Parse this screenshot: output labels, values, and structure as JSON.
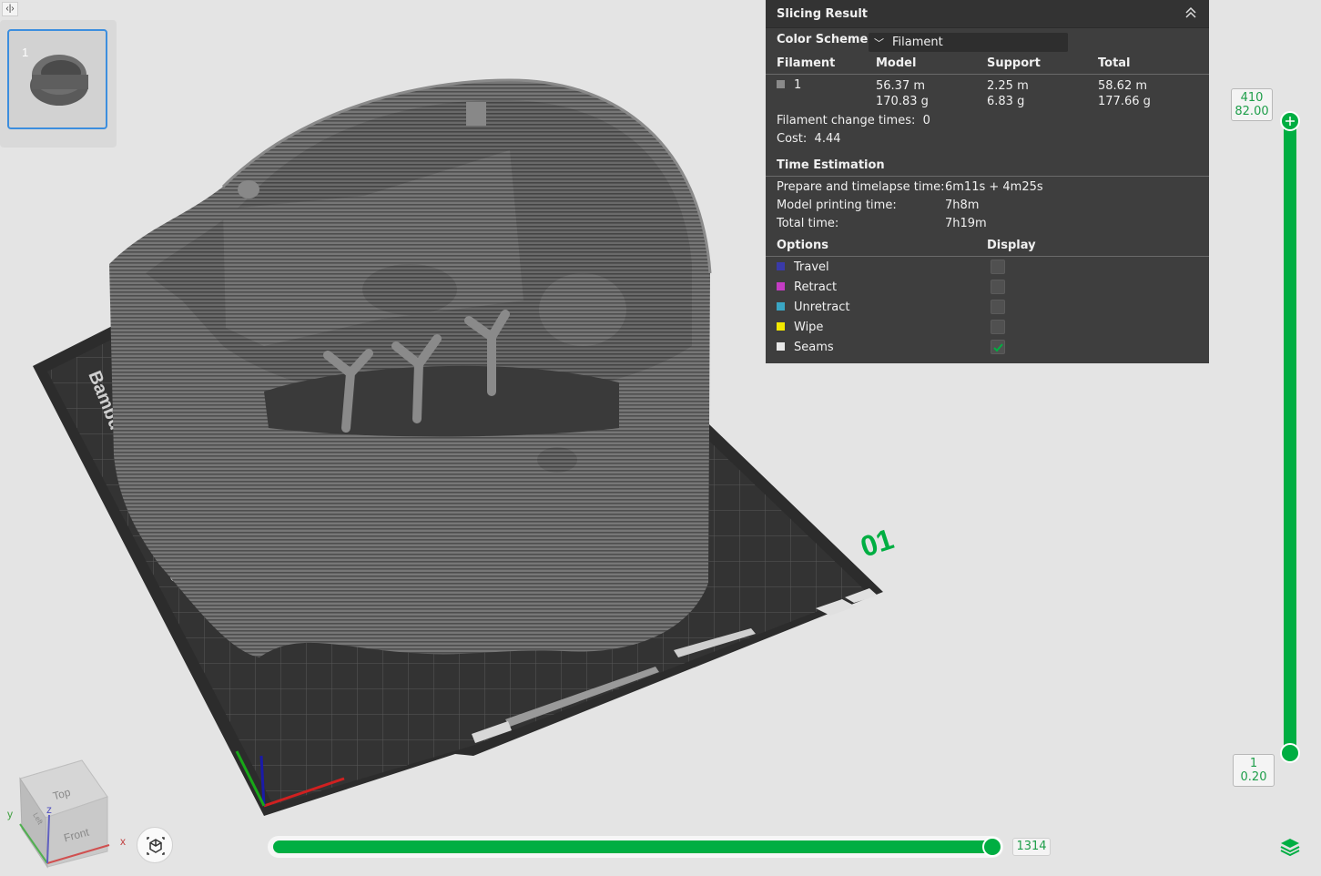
{
  "thumbnail": {
    "plate_number": "1"
  },
  "bed": {
    "plate_label": "01",
    "brand_text": "Bambu Textured PEI Plate"
  },
  "navcube": {
    "top": "Top",
    "front": "Front",
    "left": "Left",
    "axis_x": "x",
    "axis_y": "y",
    "axis_z": "z"
  },
  "panel": {
    "title": "Slicing Result",
    "color_scheme_label": "Color Scheme",
    "color_scheme_value": "Filament",
    "columns": [
      "Filament",
      "Model",
      "Support",
      "Total"
    ],
    "filament_row": {
      "id": "1",
      "color": "#8a8a8a",
      "model_len": "56.37 m",
      "model_wt": "170.83 g",
      "support_len": "2.25 m",
      "support_wt": "6.83 g",
      "total_len": "58.62 m",
      "total_wt": "177.66 g"
    },
    "change_times_label": "Filament change times:",
    "change_times_value": "0",
    "cost_label": "Cost:",
    "cost_value": "4.44",
    "time_section": "Time Estimation",
    "prepare_label": "Prepare and timelapse time:",
    "prepare_value": "6m11s + 4m25s",
    "model_time_label": "Model printing time:",
    "model_time_value": "7h8m",
    "total_time_label": "Total time:",
    "total_time_value": "7h19m",
    "options_header": "Options",
    "display_header": "Display",
    "options": [
      {
        "label": "Travel",
        "color": "#3a3aa8",
        "checked": false
      },
      {
        "label": "Retract",
        "color": "#c43cc4",
        "checked": false
      },
      {
        "label": "Unretract",
        "color": "#3aa6c4",
        "checked": false
      },
      {
        "label": "Wipe",
        "color": "#f2e800",
        "checked": false
      },
      {
        "label": "Seams",
        "color": "#e8e8e8",
        "checked": true
      }
    ]
  },
  "layer_slider": {
    "top_layer": "410",
    "top_height": "82.00",
    "bottom_layer": "1",
    "bottom_height": "0.20"
  },
  "move_slider": {
    "value": "1314"
  },
  "colors": {
    "accent": "#00ae42",
    "panel_bg": "#3e3e3e"
  }
}
